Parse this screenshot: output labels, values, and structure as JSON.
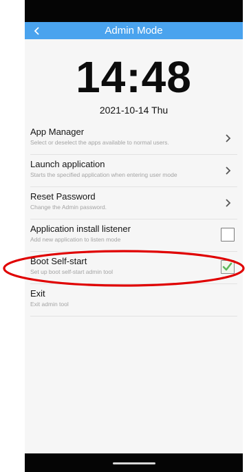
{
  "header": {
    "title": "Admin Mode"
  },
  "clock": {
    "time": "14:48",
    "date": "2021-10-14 Thu"
  },
  "menu": {
    "items": [
      {
        "title": "App Manager",
        "subtitle": "Select or deselect the apps available to normal users.",
        "control": "chevron"
      },
      {
        "title": "Launch application",
        "subtitle": "Starts the specified application when entering user mode",
        "control": "chevron"
      },
      {
        "title": "Reset Password",
        "subtitle": "Change the Admin password.",
        "control": "chevron"
      },
      {
        "title": "Application install listener",
        "subtitle": "Add new application to listen mode",
        "control": "checkbox",
        "checked": false
      },
      {
        "title": "Boot Self-start",
        "subtitle": "Set up boot self-start admin tool",
        "control": "checkbox",
        "checked": true
      },
      {
        "title": "Exit",
        "subtitle": "Exit admin tool",
        "control": "none"
      }
    ]
  },
  "colors": {
    "app_bar": "#4aa3ee",
    "check_mark": "#5cb85c",
    "annotation": "#e00000"
  },
  "icons": {
    "back": "chevron-left-icon",
    "chevron": "chevron-right-icon",
    "check": "check-icon"
  }
}
